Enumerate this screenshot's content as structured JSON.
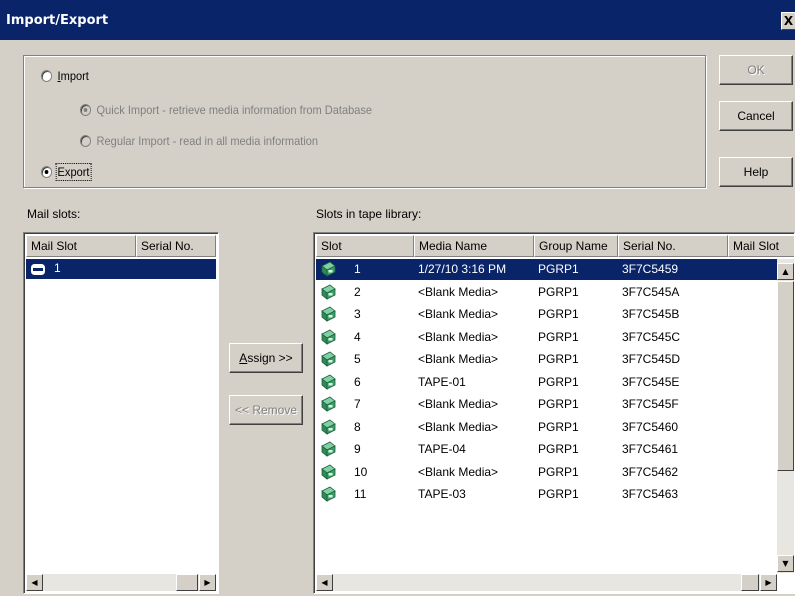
{
  "window": {
    "title": "Import/Export",
    "close_label": "X"
  },
  "options": {
    "import_label": "Import",
    "quick_import_label": "Quick Import - retrieve media information from Database",
    "regular_import_label": "Regular Import - read in all media information",
    "export_label": "Export",
    "selected": "export"
  },
  "buttons": {
    "ok": "OK",
    "cancel": "Cancel",
    "help": "Help",
    "assign": "Assign >>",
    "remove": "<< Remove"
  },
  "mail_slots": {
    "label": "Mail slots:",
    "columns": [
      "Mail Slot",
      "Serial No."
    ],
    "rows": [
      {
        "slot": "1",
        "serial": ""
      }
    ]
  },
  "library": {
    "label": "Slots in tape library:",
    "columns": [
      "Slot",
      "Media Name",
      "Group Name",
      "Serial No.",
      "Mail Slot"
    ],
    "rows": [
      {
        "slot": "1",
        "media": "1/27/10 3:16 PM",
        "group": "PGRP1",
        "serial": "3F7C5459"
      },
      {
        "slot": "2",
        "media": "<Blank Media>",
        "group": "PGRP1",
        "serial": "3F7C545A"
      },
      {
        "slot": "3",
        "media": "<Blank Media>",
        "group": "PGRP1",
        "serial": "3F7C545B"
      },
      {
        "slot": "4",
        "media": "<Blank Media>",
        "group": "PGRP1",
        "serial": "3F7C545C"
      },
      {
        "slot": "5",
        "media": "<Blank Media>",
        "group": "PGRP1",
        "serial": "3F7C545D"
      },
      {
        "slot": "6",
        "media": "TAPE-01",
        "group": "PGRP1",
        "serial": "3F7C545E"
      },
      {
        "slot": "7",
        "media": "<Blank Media>",
        "group": "PGRP1",
        "serial": "3F7C545F"
      },
      {
        "slot": "8",
        "media": "<Blank Media>",
        "group": "PGRP1",
        "serial": "3F7C5460"
      },
      {
        "slot": "9",
        "media": "TAPE-04",
        "group": "PGRP1",
        "serial": "3F7C5461"
      },
      {
        "slot": "10",
        "media": "<Blank Media>",
        "group": "PGRP1",
        "serial": "3F7C5462"
      },
      {
        "slot": "11",
        "media": "TAPE-03",
        "group": "PGRP1",
        "serial": "3F7C5463"
      }
    ]
  },
  "colors": {
    "title_bar": "#0a246a",
    "selection": "#0a246a",
    "dialog_bg": "#d4d0c8",
    "tape_icon": "#2e8b57"
  }
}
